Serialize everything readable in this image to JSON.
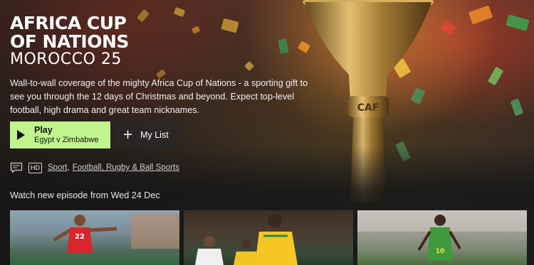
{
  "hero": {
    "logo_line1": "AFRICA CUP",
    "logo_line2": "OF NATIONS",
    "logo_line3": "MOROCCO 25",
    "description": "Wall-to-wall coverage of the mighty Africa Cup of Nations - a sporting gift to see you through the 12 days of Christmas and beyond. Expect top-level football, high drama and great team nicknames.",
    "trophy_text": "CAF"
  },
  "actions": {
    "play_label": "Play",
    "play_sub": "Egypt v Zimbabwe",
    "mylist_label": "My List"
  },
  "meta": {
    "subtitles_icon": "subtitles-icon",
    "hd_badge": "HD",
    "categories": [
      "Sport",
      "Football, Rugby & Ball Sports"
    ],
    "separator": ","
  },
  "upcoming": {
    "text": "Watch new episode from Wed 24 Dec"
  },
  "thumbnails": [
    {
      "shirt_number": "22"
    },
    {
      "shirt_number": ""
    },
    {
      "shirt_number": "10"
    }
  ],
  "colors": {
    "accent": "#bff58c",
    "background": "#1b1b1b"
  }
}
